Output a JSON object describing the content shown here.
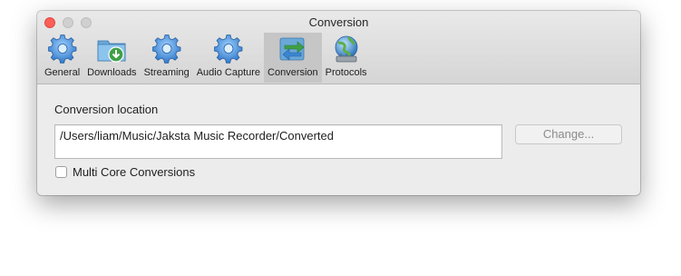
{
  "window": {
    "title": "Conversion"
  },
  "toolbar": {
    "tabs": [
      {
        "label": "General",
        "icon": "gear-icon",
        "selected": false
      },
      {
        "label": "Downloads",
        "icon": "download-folder-icon",
        "selected": false
      },
      {
        "label": "Streaming",
        "icon": "gear-icon",
        "selected": false
      },
      {
        "label": "Audio Capture",
        "icon": "gear-icon",
        "selected": false
      },
      {
        "label": "Conversion",
        "icon": "conversion-arrows-icon",
        "selected": true
      },
      {
        "label": "Protocols",
        "icon": "globe-network-icon",
        "selected": false
      }
    ]
  },
  "conversion": {
    "section_label": "Conversion location",
    "path_value": "/Users/liam/Music/Jaksta Music Recorder/Converted",
    "change_button": "Change...",
    "multi_core_label": "Multi Core Conversions",
    "multi_core_checked": false
  },
  "colors": {
    "close_light": "#fc5f57",
    "selected_tab_bg": "#c6c6c6",
    "gear_blue": "#4a90d9"
  }
}
